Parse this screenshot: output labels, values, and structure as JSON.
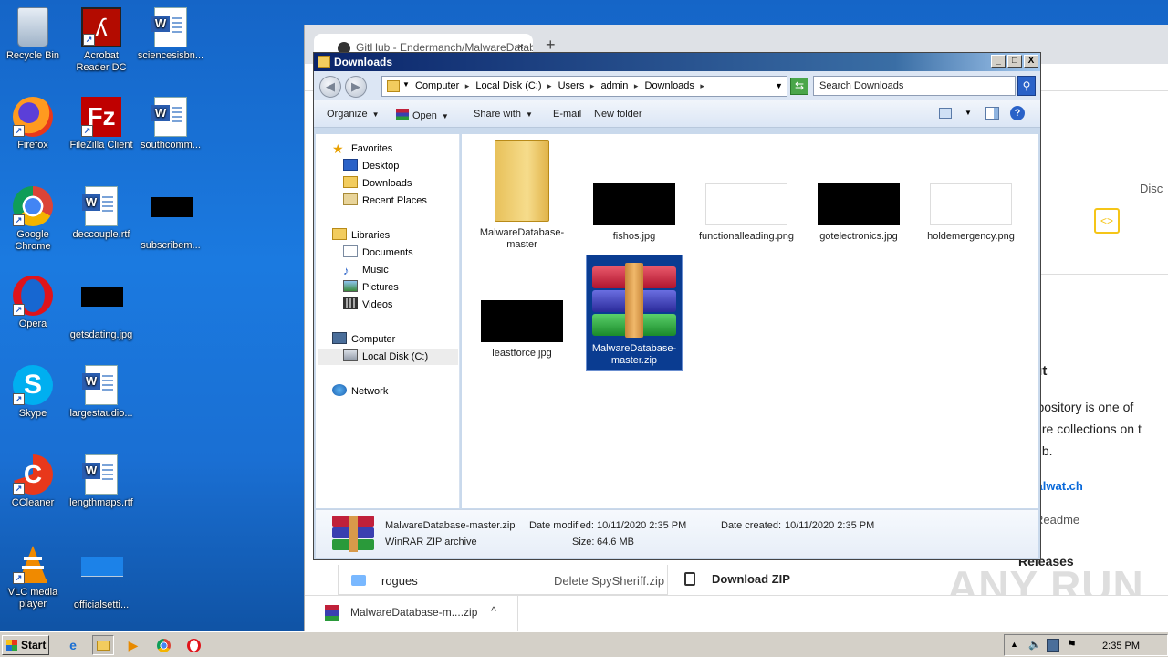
{
  "desktop": {
    "icons": [
      {
        "label": "Recycle Bin",
        "icon": "recycle-bin-icon"
      },
      {
        "label": "Acrobat Reader DC",
        "icon": "acrobat-icon"
      },
      {
        "label": "sciencesisbn...",
        "icon": "word-document-icon"
      },
      {
        "label": "Firefox",
        "icon": "firefox-icon"
      },
      {
        "label": "FileZilla Client",
        "icon": "filezilla-icon"
      },
      {
        "label": "southcomm...",
        "icon": "word-document-icon"
      },
      {
        "label": "Google Chrome",
        "icon": "chrome-icon"
      },
      {
        "label": "deccouple.rtf",
        "icon": "word-document-icon"
      },
      {
        "label": "subscribem...",
        "icon": "black-image-icon"
      },
      {
        "label": "Opera",
        "icon": "opera-icon"
      },
      {
        "label": "getsdating.jpg",
        "icon": "black-image-icon"
      },
      {
        "label": "Skype",
        "icon": "skype-icon"
      },
      {
        "label": "largestaudio...",
        "icon": "word-document-icon"
      },
      {
        "label": "CCleaner",
        "icon": "ccleaner-icon"
      },
      {
        "label": "lengthmaps.rtf",
        "icon": "word-document-icon"
      },
      {
        "label": "VLC media player",
        "icon": "vlc-icon"
      },
      {
        "label": "officialsetti...",
        "icon": "image-icon"
      }
    ]
  },
  "browser": {
    "tab_title": "GitHub - Endermanch/MalwareDatab",
    "new_tab": "+",
    "side_text": {
      "about_heading": "out",
      "desc_line1": "repository is one of",
      "desc_line2": "ware collections on t",
      "desc_line3": "Hub.",
      "link": "malwat.ch",
      "readme": "Readme",
      "releases": "Releases",
      "disc": "Disc"
    },
    "file_list": {
      "folder_name": "rogues",
      "commit_msg": "Delete SpySheriff.zip",
      "download_zip": "Download ZIP"
    },
    "download_bar": {
      "filename": "MalwareDatabase-m....zip",
      "chevron": "^"
    },
    "watermark": "ANY RUN"
  },
  "explorer": {
    "title": "Downloads",
    "controls": {
      "minimize": "_",
      "maximize": "□",
      "close": "X"
    },
    "breadcrumb": [
      "Computer",
      "Local Disk (C:)",
      "Users",
      "admin",
      "Downloads"
    ],
    "search_placeholder": "Search Downloads",
    "toolbar": {
      "organize": "Organize",
      "open": "Open",
      "share_with": "Share with",
      "email": "E-mail",
      "new_folder": "New folder"
    },
    "nav": {
      "favorites": "Favorites",
      "desktop": "Desktop",
      "downloads": "Downloads",
      "recent_places": "Recent Places",
      "libraries": "Libraries",
      "documents": "Documents",
      "music": "Music",
      "pictures": "Pictures",
      "videos": "Videos",
      "computer": "Computer",
      "local_disk": "Local Disk (C:)",
      "network": "Network"
    },
    "files": {
      "f1": "MalwareDatabase-master",
      "f2": "fishos.jpg",
      "f3": "functionalleading.png",
      "f4": "gotelectronics.jpg",
      "f5": "holdemergency.png",
      "f6": "leastforce.jpg",
      "f7": "MalwareDatabase-master.zip"
    },
    "details": {
      "name": "MalwareDatabase-master.zip",
      "date_modified_label": "Date modified:",
      "date_modified": "10/11/2020 2:35 PM",
      "date_created_label": "Date created:",
      "date_created": "10/11/2020 2:35 PM",
      "type": "WinRAR ZIP archive",
      "size_label": "Size:",
      "size": "64.6 MB"
    }
  },
  "taskbar": {
    "start": "Start",
    "clock": "2:35 PM"
  }
}
